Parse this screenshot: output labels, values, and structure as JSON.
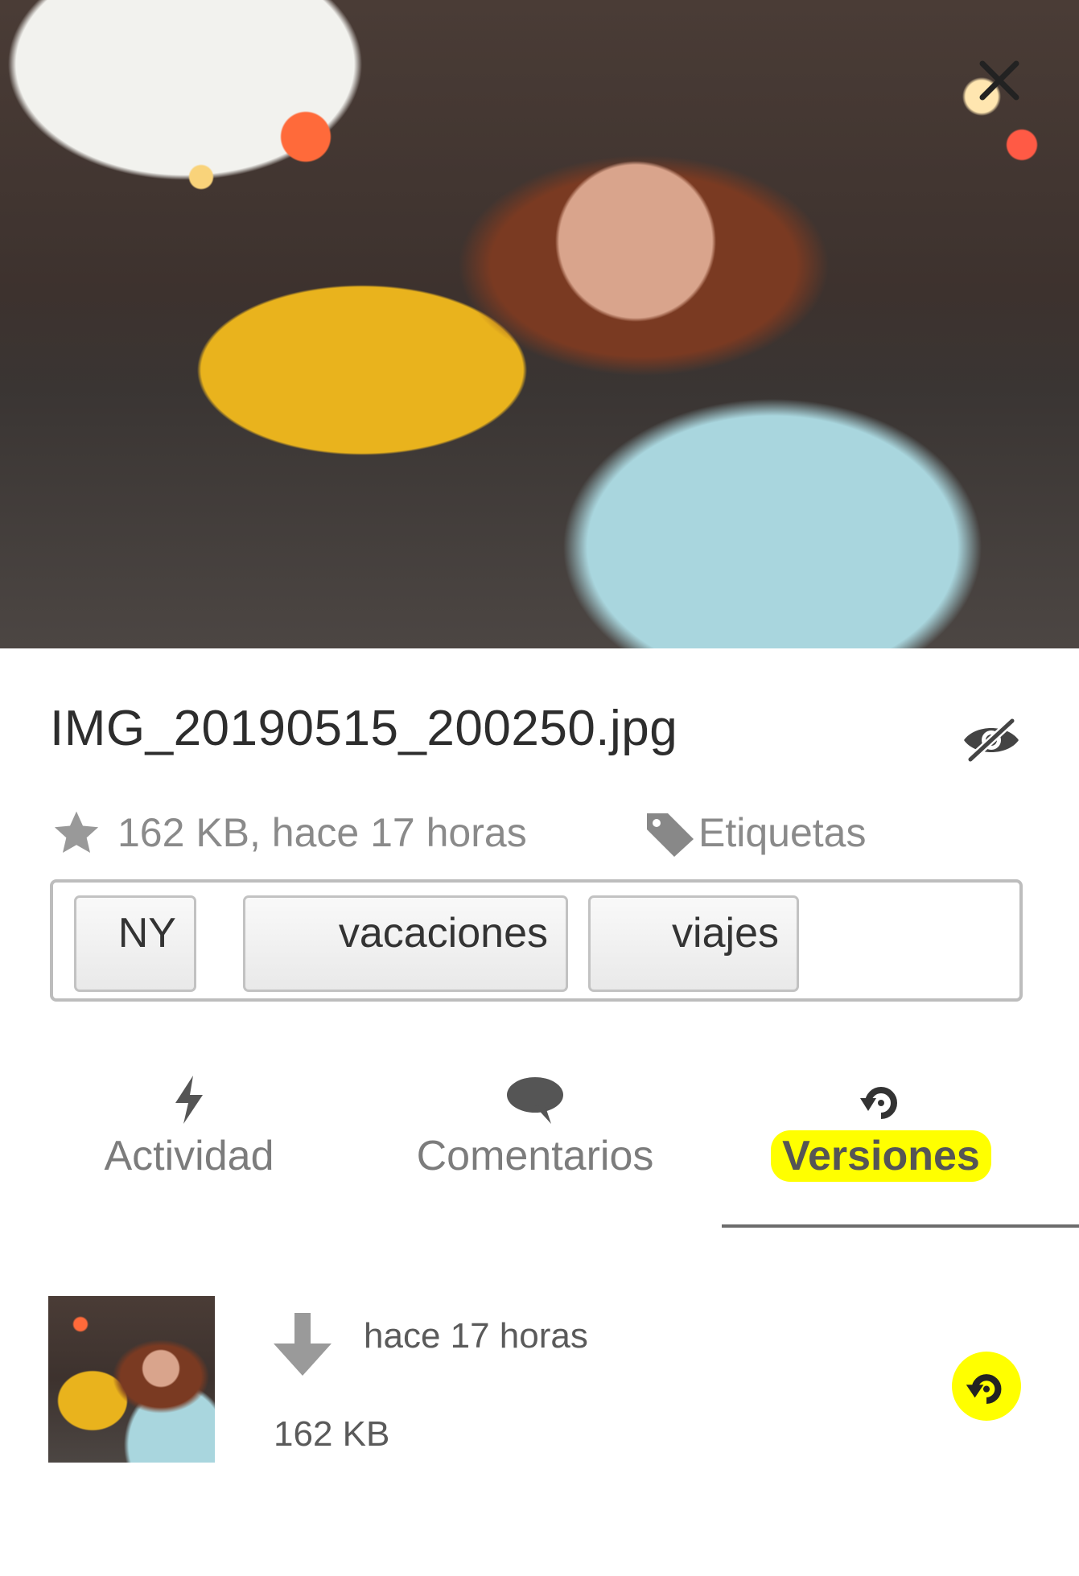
{
  "preview": {
    "icon": "photo-preview"
  },
  "close": {
    "icon": "close-icon"
  },
  "file": {
    "name": "IMG_20190515_200250.jpg",
    "meta": "162 KB, hace 17 horas",
    "favorite_icon": "star-icon",
    "hide_icon": "eye-off-icon"
  },
  "tags": {
    "label": "Etiquetas",
    "icon": "tag-icon",
    "items": [
      "NY",
      "vacaciones",
      "viajes"
    ]
  },
  "tabs": [
    {
      "label": "Actividad",
      "icon": "lightning-icon",
      "active": false
    },
    {
      "label": "Comentarios",
      "icon": "comment-icon",
      "active": false
    },
    {
      "label": "Versiones",
      "icon": "history-icon",
      "active": true
    }
  ],
  "versions": [
    {
      "time": "hace 17 horas",
      "size": "162 KB",
      "download_icon": "download-icon",
      "restore_icon": "restore-icon"
    }
  ],
  "colors": {
    "highlight": "#ffff00",
    "text": "#2d2d2d",
    "muted": "#8a8a8a",
    "border": "#bdbdbd"
  }
}
